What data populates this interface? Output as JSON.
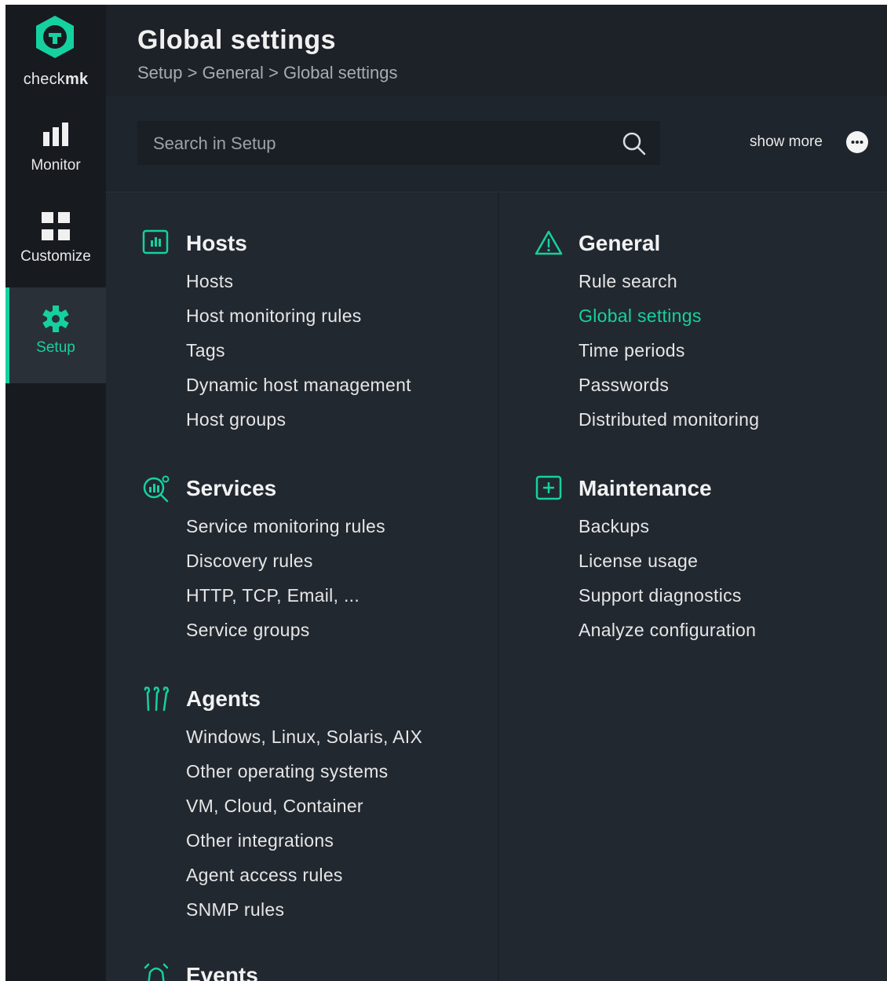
{
  "app": {
    "logo_text_light": "check",
    "logo_text_bold": "mk"
  },
  "nav": [
    {
      "label": "Monitor",
      "icon": "bar-chart-icon"
    },
    {
      "label": "Customize",
      "icon": "grid-icon"
    },
    {
      "label": "Setup",
      "icon": "gear-icon",
      "active": true
    }
  ],
  "header": {
    "title": "Global settings",
    "breadcrumb": [
      "Setup",
      "General",
      "Global settings"
    ],
    "separator": ">"
  },
  "search": {
    "placeholder": "Search in Setup",
    "value": "",
    "icon": "search-icon"
  },
  "show_more": {
    "label": "show more",
    "icon": "more-dots-icon"
  },
  "groups": {
    "hosts": {
      "title": "Hosts",
      "icon": "host-icon",
      "items": [
        "Hosts",
        "Host monitoring rules",
        "Tags",
        "Dynamic host management",
        "Host groups"
      ]
    },
    "services": {
      "title": "Services",
      "icon": "services-icon",
      "items": [
        "Service monitoring rules",
        "Discovery rules",
        "HTTP, TCP, Email, ...",
        "Service groups"
      ]
    },
    "agents": {
      "title": "Agents",
      "icon": "agents-icon",
      "items": [
        "Windows, Linux, Solaris, AIX",
        "Other operating systems",
        "VM, Cloud, Container",
        "Other integrations",
        "Agent access rules",
        "SNMP rules"
      ]
    },
    "events": {
      "title": "Events",
      "icon": "events-icon"
    },
    "general": {
      "title": "General",
      "icon": "warning-icon",
      "items": [
        "Rule search",
        "Global settings",
        "Time periods",
        "Passwords",
        "Distributed monitoring"
      ],
      "active_item": "Global settings"
    },
    "maintenance": {
      "title": "Maintenance",
      "icon": "plus-box-icon",
      "items": [
        "Backups",
        "License usage",
        "Support diagnostics",
        "Analyze configuration"
      ]
    }
  },
  "colors": {
    "accent": "#15d1a0",
    "background": "#222830",
    "sidebar": "#171b20",
    "header": "#1d2228"
  }
}
